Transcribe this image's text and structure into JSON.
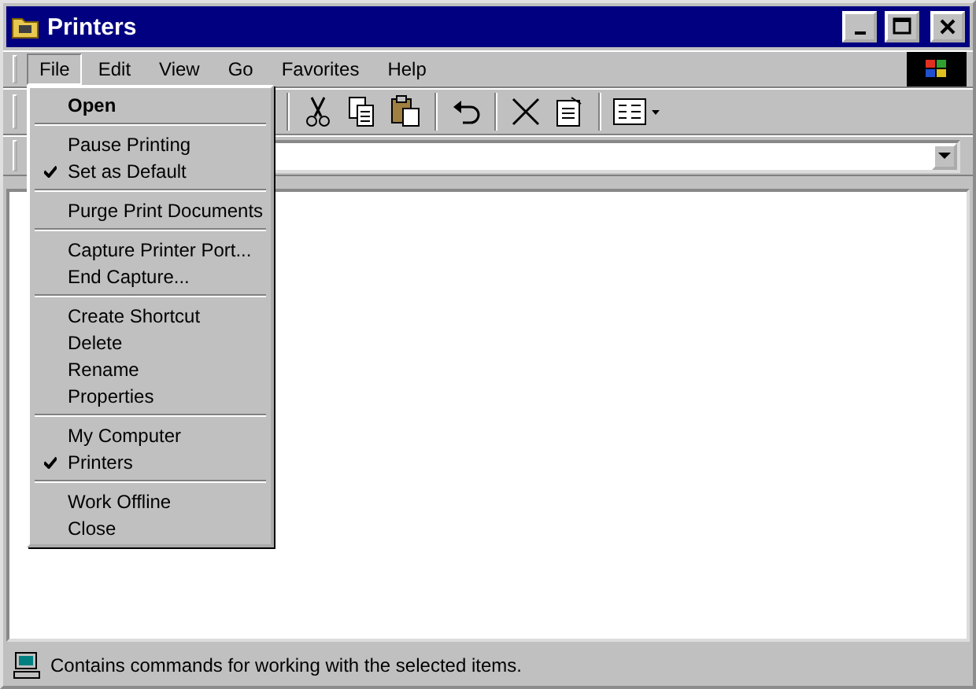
{
  "window": {
    "title": "Printers"
  },
  "menu_bar": [
    {
      "label": "File",
      "selected": true
    },
    {
      "label": "Edit",
      "selected": false
    },
    {
      "label": "View",
      "selected": false
    },
    {
      "label": "Go",
      "selected": false
    },
    {
      "label": "Favorites",
      "selected": false
    },
    {
      "label": "Help",
      "selected": false
    }
  ],
  "file_menu": {
    "groups": [
      [
        {
          "label": "Open",
          "checked": false,
          "default": true
        }
      ],
      [
        {
          "label": "Pause Printing",
          "checked": false,
          "default": false
        },
        {
          "label": "Set as Default",
          "checked": true,
          "default": false
        }
      ],
      [
        {
          "label": "Purge Print Documents",
          "checked": false,
          "default": false
        }
      ],
      [
        {
          "label": "Capture Printer Port...",
          "checked": false,
          "default": false
        },
        {
          "label": "End Capture...",
          "checked": false,
          "default": false
        }
      ],
      [
        {
          "label": "Create Shortcut",
          "checked": false,
          "default": false
        },
        {
          "label": "Delete",
          "checked": false,
          "default": false
        },
        {
          "label": "Rename",
          "checked": false,
          "default": false
        },
        {
          "label": "Properties",
          "checked": false,
          "default": false
        }
      ],
      [
        {
          "label": "My Computer",
          "checked": false,
          "default": false
        },
        {
          "label": "Printers",
          "checked": true,
          "default": false
        }
      ],
      [
        {
          "label": "Work Offline",
          "checked": false,
          "default": false
        },
        {
          "label": "Close",
          "checked": false,
          "default": false
        }
      ]
    ]
  },
  "status_bar": {
    "text": "Contains commands for working with the selected items."
  }
}
